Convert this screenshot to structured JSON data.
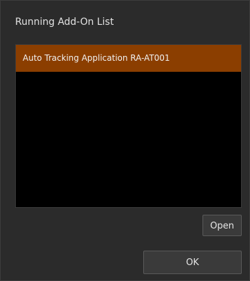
{
  "dialog": {
    "title": "Running Add-On List"
  },
  "addon_list": {
    "items": [
      {
        "label": "Auto Tracking Application RA-AT001",
        "selected": true
      }
    ]
  },
  "buttons": {
    "open_label": "Open",
    "ok_label": "OK"
  },
  "colors": {
    "dialog_bg": "#2b2b2b",
    "list_bg": "#000000",
    "selection": "#8b3e00",
    "button_bg": "#3a3a3a"
  }
}
